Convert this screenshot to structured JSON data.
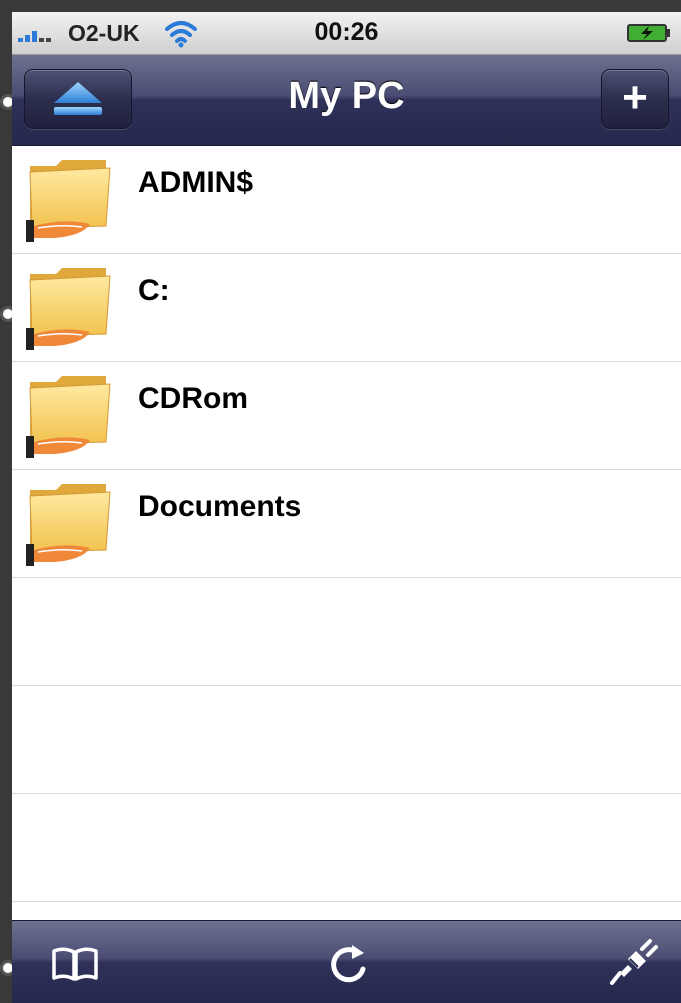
{
  "status_bar": {
    "carrier": "O2-UK",
    "time": "00:26",
    "icons": [
      "signal-icon",
      "wifi-icon",
      "battery-charging-icon"
    ]
  },
  "nav_bar": {
    "title": "My PC",
    "left_button_icon": "eject-icon",
    "right_button_icon": "plus-icon",
    "right_button_label": "+"
  },
  "list": {
    "items": [
      {
        "label": "ADMIN$",
        "icon": "shared-folder-icon"
      },
      {
        "label": "C:",
        "icon": "shared-folder-icon"
      },
      {
        "label": "CDRom",
        "icon": "shared-folder-icon"
      },
      {
        "label": "Documents",
        "icon": "shared-folder-icon"
      }
    ]
  },
  "toolbar": {
    "icons": [
      "bookmarks-icon",
      "refresh-icon",
      "disconnect-plug-icon"
    ]
  },
  "colors": {
    "bar_dark": "#25284d",
    "bar_light": "#6f7190",
    "eject_blue": "#5aa9f0",
    "folder_yellow": "#f7d36a",
    "hand_orange": "#f0883a"
  }
}
